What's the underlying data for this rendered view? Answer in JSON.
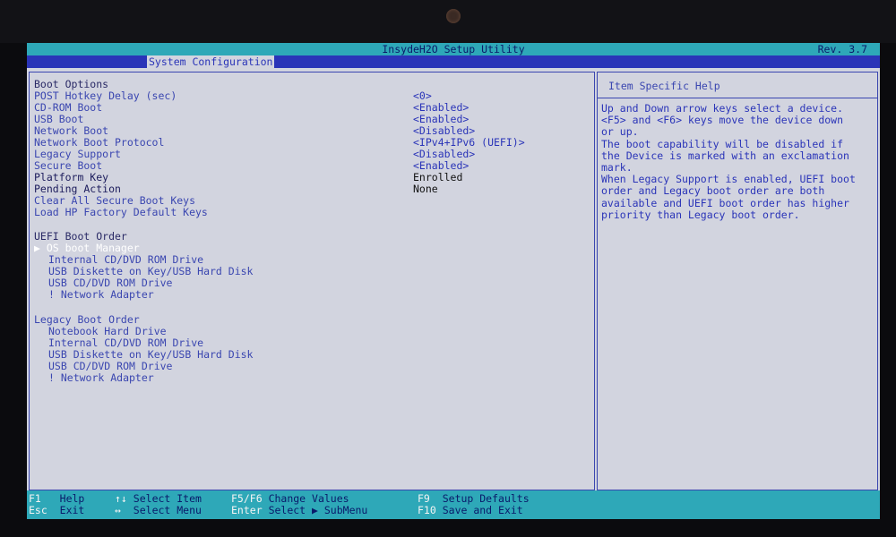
{
  "title": "InsydeH2O Setup Utility",
  "revision": "Rev. 3.7",
  "active_tab": "System Configuration",
  "boot_options": {
    "header": "Boot Options",
    "items": [
      {
        "label": "POST Hotkey Delay (sec)",
        "value": "<0>"
      },
      {
        "label": "CD-ROM Boot",
        "value": "<Enabled>"
      },
      {
        "label": "USB Boot",
        "value": "<Enabled>"
      },
      {
        "label": "Network Boot",
        "value": "<Disabled>"
      },
      {
        "label": "Network Boot Protocol",
        "value": "<IPv4+IPv6 (UEFI)>"
      },
      {
        "label": "Legacy Support",
        "value": "<Disabled>"
      },
      {
        "label": "Secure Boot",
        "value": "<Enabled>"
      },
      {
        "label": "Platform Key",
        "value": "Enrolled"
      },
      {
        "label": "Pending Action",
        "value": "None"
      },
      {
        "label": "Clear All Secure Boot Keys",
        "value": ""
      },
      {
        "label": "Load HP Factory Default Keys",
        "value": ""
      }
    ]
  },
  "uefi_boot_order": {
    "header": "UEFI Boot Order",
    "items": [
      "▶ OS boot Manager",
      "Internal CD/DVD ROM Drive",
      "USB Diskette on Key/USB Hard Disk",
      "USB CD/DVD ROM Drive",
      "! Network Adapter"
    ]
  },
  "legacy_boot_order": {
    "header": "Legacy Boot Order",
    "items": [
      "Notebook Hard Drive",
      "Internal CD/DVD ROM Drive",
      "USB Diskette on Key/USB Hard Disk",
      "USB CD/DVD ROM Drive",
      "! Network Adapter"
    ]
  },
  "help": {
    "title": "Item Specific Help",
    "lines": [
      "Up and Down arrow keys select a device.",
      "<F5> and <F6> keys move the device down",
      "or up.",
      "The boot capability will be disabled if",
      "the Device is marked with an exclamation",
      "mark.",
      "When Legacy Support is enabled, UEFI boot",
      "order and Legacy boot order are both",
      "available and UEFI boot order has higher",
      "priority than Legacy boot order."
    ]
  },
  "footer": [
    {
      "key": "F1",
      "action": "Help"
    },
    {
      "key": "Esc",
      "action": "Exit"
    },
    {
      "key": "↑↓",
      "action": "Select Item"
    },
    {
      "key": "↔",
      "action": "Select Menu"
    },
    {
      "key": "F5/F6",
      "action": "Change Values"
    },
    {
      "key": "Enter",
      "action": "Select ▶ SubMenu"
    },
    {
      "key": "F9",
      "action": "Setup Defaults"
    },
    {
      "key": "F10",
      "action": "Save and Exit"
    }
  ]
}
